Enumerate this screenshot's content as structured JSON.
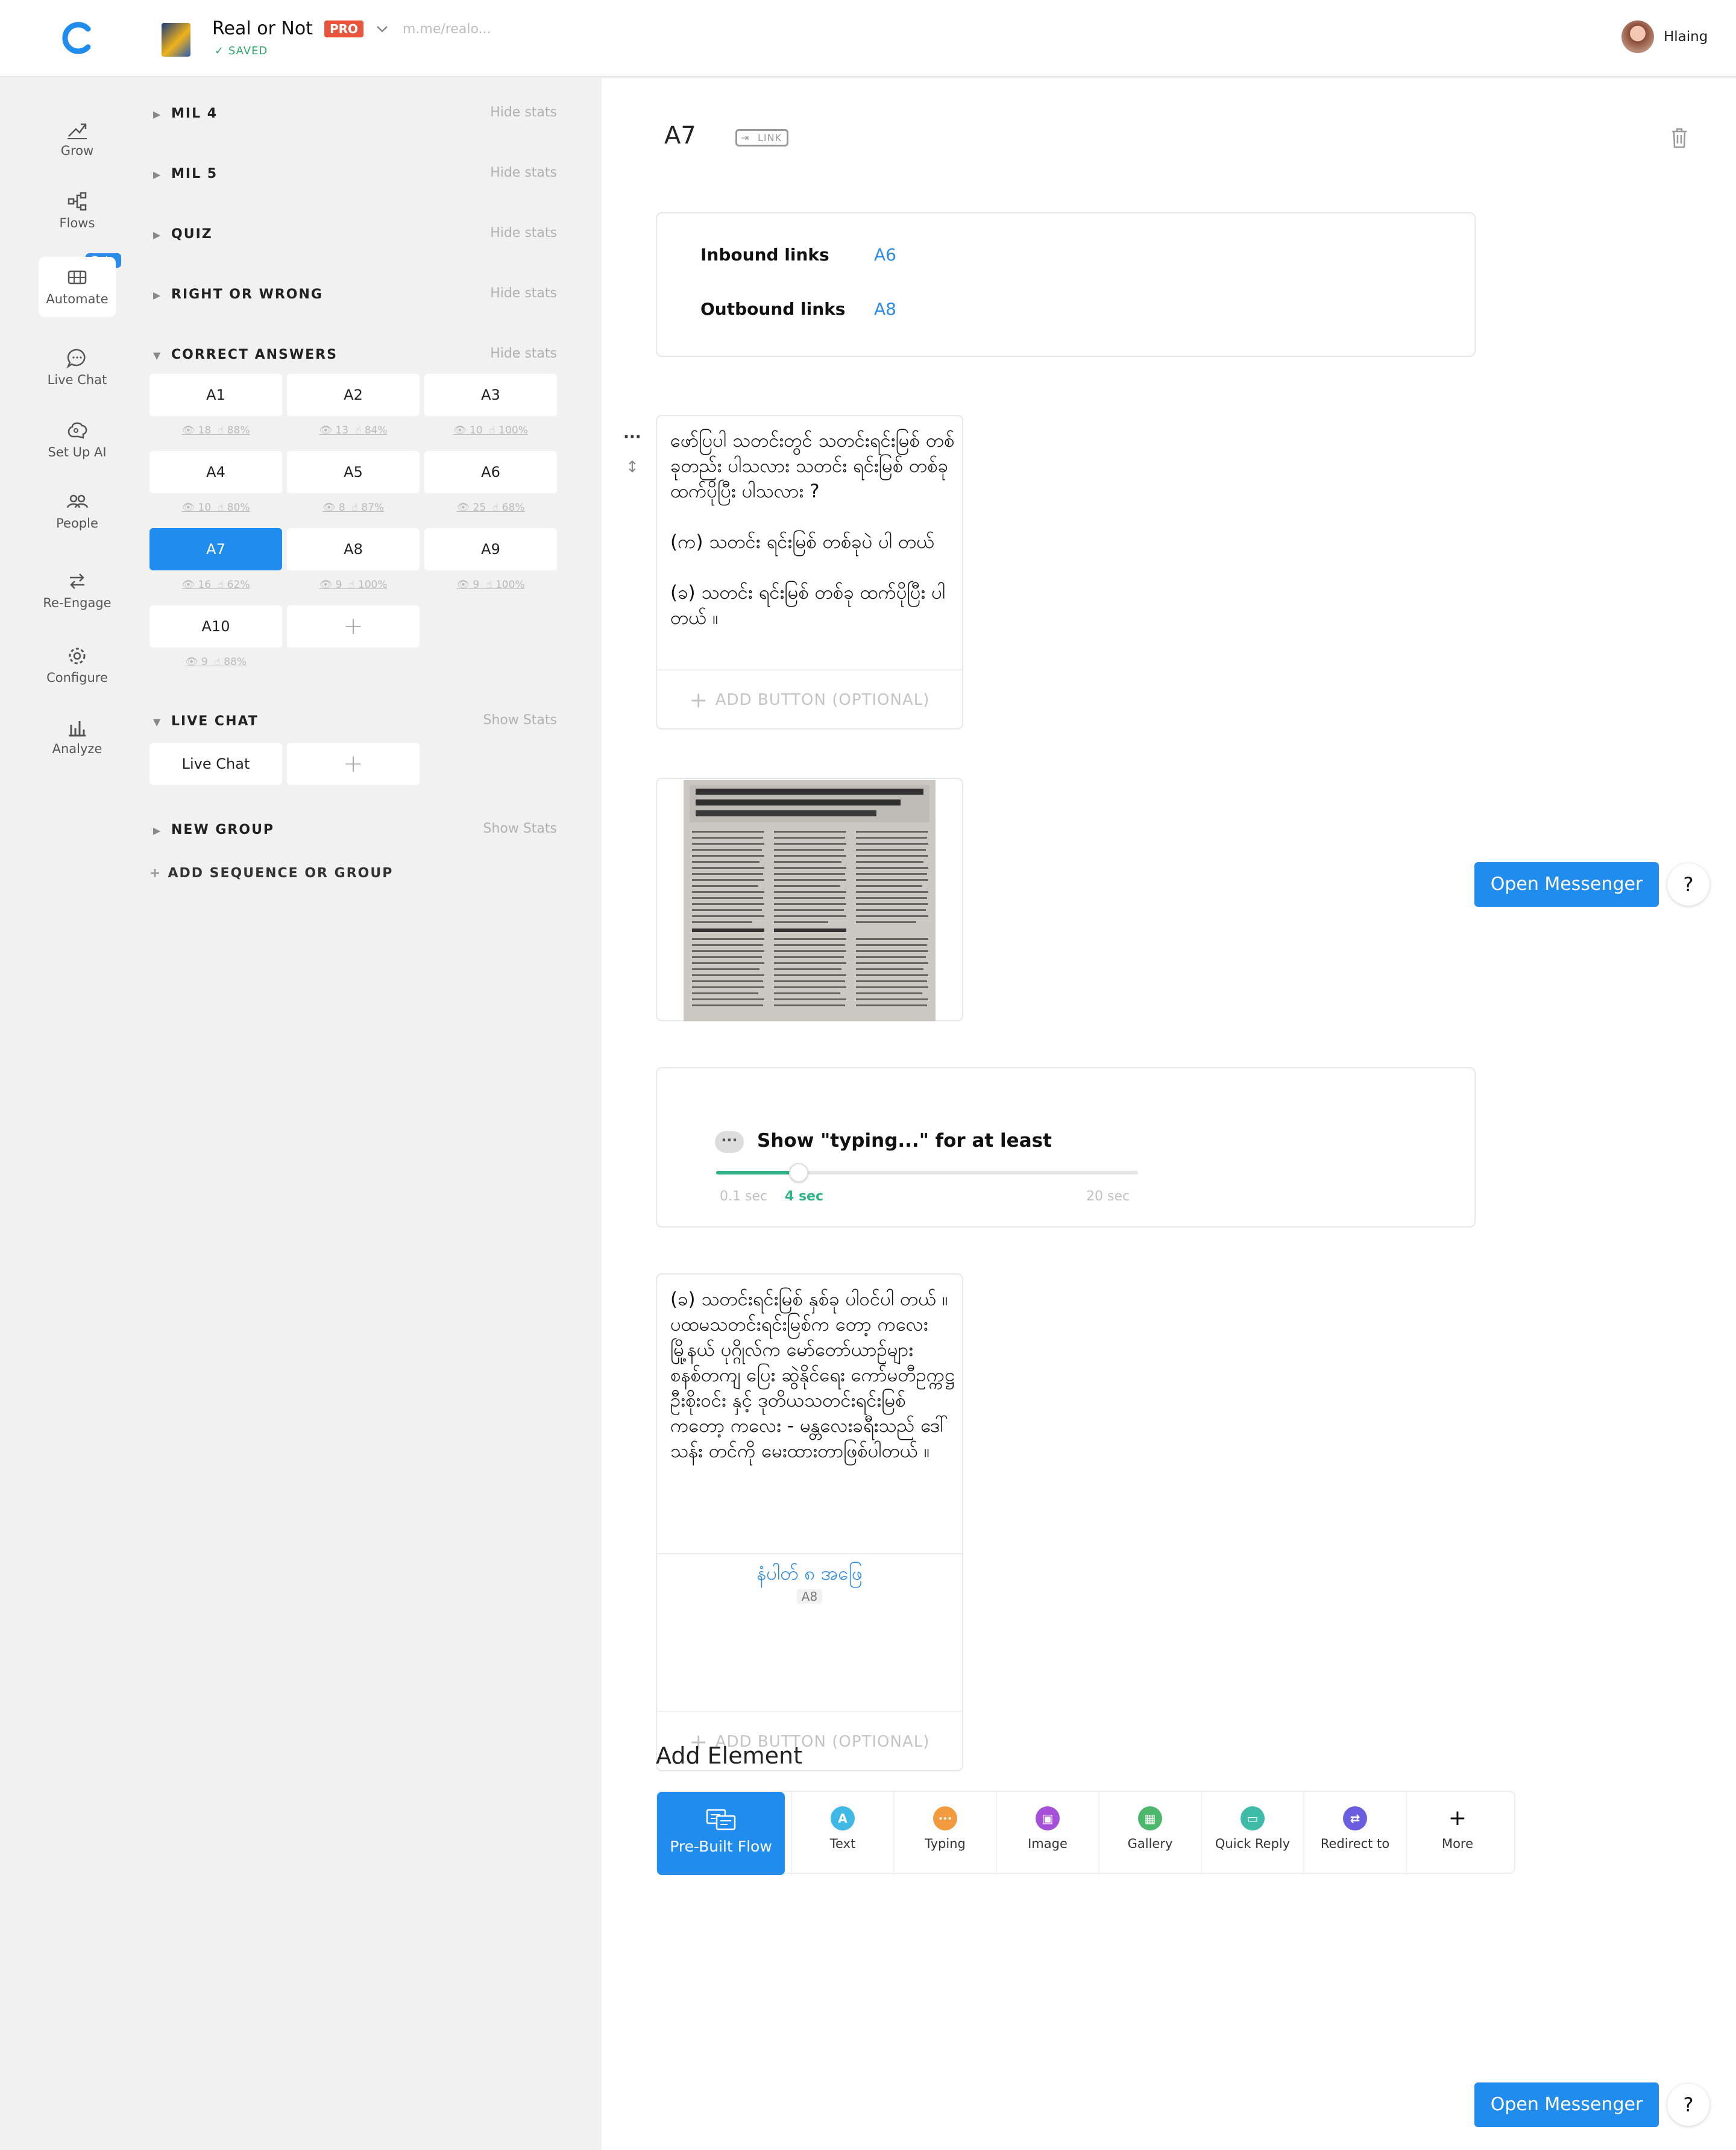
{
  "header": {
    "bot_name": "Real or Not",
    "plan_badge": "PRO",
    "bot_url": "m.me/realo...",
    "save_status": "SAVED",
    "user_name": "Hlaing"
  },
  "nav": {
    "items": [
      {
        "label": "Grow"
      },
      {
        "label": "Flows"
      },
      {
        "label": "Automate"
      },
      {
        "label": "Live Chat"
      },
      {
        "label": "Set Up AI"
      },
      {
        "label": "People"
      },
      {
        "label": "Re-Engage"
      },
      {
        "label": "Configure"
      },
      {
        "label": "Analyze"
      }
    ],
    "beta_badge": "Beta"
  },
  "groups": [
    {
      "name": "MIL 4",
      "stats_toggle": "Hide stats"
    },
    {
      "name": "MIL 5",
      "stats_toggle": "Hide stats"
    },
    {
      "name": "QUIZ",
      "stats_toggle": "Hide stats"
    },
    {
      "name": "RIGHT OR WRONG",
      "stats_toggle": "Hide stats"
    },
    {
      "name": "CORRECT ANSWERS",
      "stats_toggle": "Hide stats"
    },
    {
      "name": "LIVE CHAT",
      "stats_toggle": "Show Stats"
    },
    {
      "name": "NEW GROUP",
      "stats_toggle": "Show Stats"
    }
  ],
  "correct_answers": [
    {
      "label": "A1",
      "views": "18",
      "clicks": "88%"
    },
    {
      "label": "A2",
      "views": "13",
      "clicks": "84%"
    },
    {
      "label": "A3",
      "views": "10",
      "clicks": "100%"
    },
    {
      "label": "A4",
      "views": "10",
      "clicks": "80%"
    },
    {
      "label": "A5",
      "views": "8",
      "clicks": "87%"
    },
    {
      "label": "A6",
      "views": "25",
      "clicks": "68%"
    },
    {
      "label": "A7",
      "views": "16",
      "clicks": "62%"
    },
    {
      "label": "A8",
      "views": "9",
      "clicks": "100%"
    },
    {
      "label": "A9",
      "views": "9",
      "clicks": "100%"
    },
    {
      "label": "A10",
      "views": "9",
      "clicks": "88%"
    }
  ],
  "live_chat_tile": "Live Chat",
  "add_sequence_label": "ADD SEQUENCE OR GROUP",
  "message": {
    "title": "A7",
    "link_chip": "LINK",
    "inbound_label": "Inbound links",
    "inbound_value": "A6",
    "outbound_label": "Outbound links",
    "outbound_value": "A8",
    "text1": "ဖော်ပြပါ သတင်းတွင် သတင်းရင်းမြစ် တစ်ခုတည်း ပါသလား သတင်း ရင်းမြစ် တစ်ခုထက်ပိုပြီး ပါသလား ?\n\n(က) သတင်း ရင်းမြစ် တစ်ခုပဲ ပါ တယ်\n\n(ခ) သတင်း ရင်းမြစ် တစ်ခု ထက်ပိုပြီး ပါတယ် ။",
    "add_button_label": "ADD BUTTON (OPTIONAL)",
    "typing_label": "Show \"typing...\" for at least",
    "typing_min": "0.1 sec",
    "typing_value": "4 sec",
    "typing_max": "20 sec",
    "typing_seconds": 4,
    "text2": "(ခ) သတင်းရင်းမြစ် နှစ်ခု ပါဝင်ပါ တယ် ။\nပထမသတင်းရင်းမြစ်က တော့ ကလေးမြို့နယ် ပုဂ္ဂိုလ်က မော်တော်ယာဉ်များ စနစ်တကျ ပြေး ဆွဲနိုင်ရေး ကော်မတီဥက္ကဋ္ဌ ဦးစိုးဝင်း နှင့် ဒုတိယသတင်းရင်းမြစ်ကတော့ ကလေး - မန္တလေးခရီးသည် ဒေါ်သန်း တင်ကို မေးထားတာဖြစ်ပါတယ် ။",
    "button_text": "နံပါတ် ၈ အဖြေ",
    "button_target": "A8"
  },
  "add_element": {
    "title": "Add Element",
    "items": [
      {
        "label": "Pre-Built Flow"
      },
      {
        "label": "Text",
        "icon": "text-icon",
        "color": "#3fb8e6"
      },
      {
        "label": "Typing",
        "icon": "typing-icon",
        "color": "#f19a3e"
      },
      {
        "label": "Image",
        "icon": "image-icon",
        "color": "#a64fd8"
      },
      {
        "label": "Gallery",
        "icon": "gallery-icon",
        "color": "#4cb86b"
      },
      {
        "label": "Quick Reply",
        "icon": "quick-reply-icon",
        "color": "#3dbba9"
      },
      {
        "label": "Redirect to",
        "icon": "redirect-icon",
        "color": "#6a5de0"
      },
      {
        "label": "More",
        "icon": "plus-icon",
        "color": "#ffffff"
      }
    ]
  },
  "actions": {
    "open_messenger": "Open Messenger",
    "help": "?"
  },
  "colors": {
    "accent": "#1f8cee",
    "pro_badge": "#e8553f",
    "success": "#2fb386"
  }
}
